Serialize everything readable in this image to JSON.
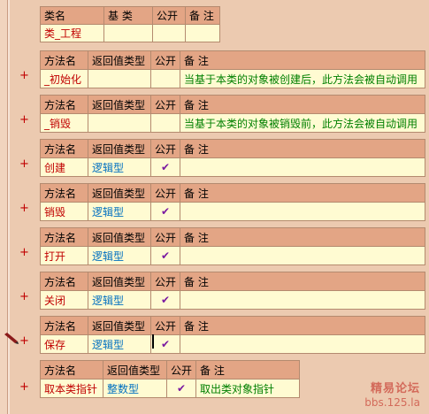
{
  "class_header": {
    "name": "类名",
    "base": "基 类",
    "public": "公开",
    "remark": "备 注"
  },
  "class_row": {
    "name": "类_工程",
    "base": "",
    "public": "",
    "remark": ""
  },
  "method_header": {
    "name": "方法名",
    "return_type": "返回值类型",
    "public": "公开",
    "remark": "备 注"
  },
  "methods": [
    {
      "name": "_初始化",
      "return_type": "",
      "public": "",
      "remark": "当基于本类的对象被创建后，此方法会被自动调用"
    },
    {
      "name": "_销毁",
      "return_type": "",
      "public": "",
      "remark": "当基于本类的对象被销毁前，此方法会被自动调用"
    },
    {
      "name": "创建",
      "return_type": "逻辑型",
      "public": "✔",
      "remark": ""
    },
    {
      "name": "销毁",
      "return_type": "逻辑型",
      "public": "✔",
      "remark": ""
    },
    {
      "name": "打开",
      "return_type": "逻辑型",
      "public": "✔",
      "remark": ""
    },
    {
      "name": "关闭",
      "return_type": "逻辑型",
      "public": "✔",
      "remark": ""
    },
    {
      "name": "保存",
      "return_type": "逻辑型",
      "public": "✔",
      "remark": ""
    },
    {
      "name": "取本类指针",
      "return_type": "整数型",
      "public": "✔",
      "remark": "取出类对象指针"
    }
  ],
  "expand_symbol": "+",
  "watermark": {
    "line1": "精易论坛",
    "line2": "bbs.125.la"
  },
  "colors": {
    "background": "#eccab0",
    "header": "#e3a585",
    "cell": "#fffbd2",
    "red_text": "#c00000",
    "blue_text": "#0070c0",
    "green_text": "#008000",
    "check": "#7a1aa0"
  }
}
